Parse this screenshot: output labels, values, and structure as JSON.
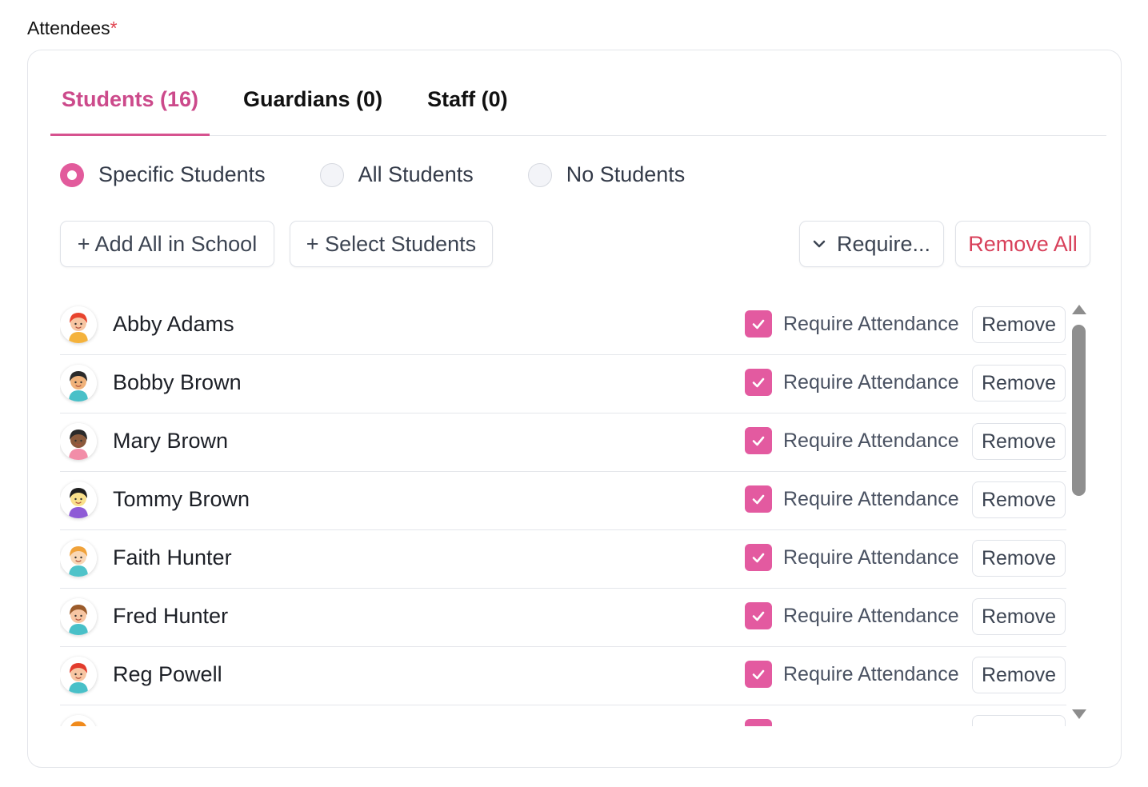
{
  "field": {
    "label": "Attendees",
    "required_mark": "*"
  },
  "tabs": [
    {
      "label": "Students (16)",
      "active": true
    },
    {
      "label": "Guardians (0)",
      "active": false
    },
    {
      "label": "Staff (0)",
      "active": false
    }
  ],
  "radios": [
    {
      "label": "Specific Students",
      "checked": true
    },
    {
      "label": "All Students",
      "checked": false
    },
    {
      "label": "No Students",
      "checked": false
    }
  ],
  "actions": {
    "add_all": "+ Add All in School",
    "select": "+ Select Students",
    "require": "Require...",
    "remove_all": "Remove All"
  },
  "students": [
    {
      "name": "Abby Adams",
      "hair": "#e8442e",
      "skin": "#f7c6a3",
      "shirt": "#f4b23c",
      "require_label": "Require Attendance",
      "remove_label": "Remove",
      "checked": true
    },
    {
      "name": "Bobby Brown",
      "hair": "#2a2a2a",
      "skin": "#f0b27a",
      "shirt": "#49c0c8",
      "require_label": "Require Attendance",
      "remove_label": "Remove",
      "checked": true
    },
    {
      "name": "Mary Brown",
      "hair": "#2a2a2a",
      "skin": "#8a5a3c",
      "shirt": "#f28da8",
      "require_label": "Require Attendance",
      "remove_label": "Remove",
      "checked": true
    },
    {
      "name": "Tommy Brown",
      "hair": "#1e1e1e",
      "skin": "#f9e08b",
      "shirt": "#8e5bd6",
      "require_label": "Require Attendance",
      "remove_label": "Remove",
      "checked": true
    },
    {
      "name": "Faith Hunter",
      "hair": "#f0a23a",
      "skin": "#f9d7b5",
      "shirt": "#4fc3c9",
      "require_label": "Require Attendance",
      "remove_label": "Remove",
      "checked": true
    },
    {
      "name": "Fred Hunter",
      "hair": "#9b5b2b",
      "skin": "#f7c6a3",
      "shirt": "#49c0c8",
      "require_label": "Require Attendance",
      "remove_label": "Remove",
      "checked": true
    },
    {
      "name": "Reg Powell",
      "hair": "#e23b2c",
      "skin": "#f7c6a3",
      "shirt": "#49c0c8",
      "require_label": "Require Attendance",
      "remove_label": "Remove",
      "checked": true
    },
    {
      "name": "",
      "hair": "#f08a1c",
      "skin": "#f7c6a3",
      "shirt": "#49c0c8",
      "require_label": "",
      "remove_label": "",
      "checked": true
    }
  ],
  "colors": {
    "accent": "#e35aa0",
    "tab_active": "#cc4a8b",
    "danger": "#d8405a"
  }
}
